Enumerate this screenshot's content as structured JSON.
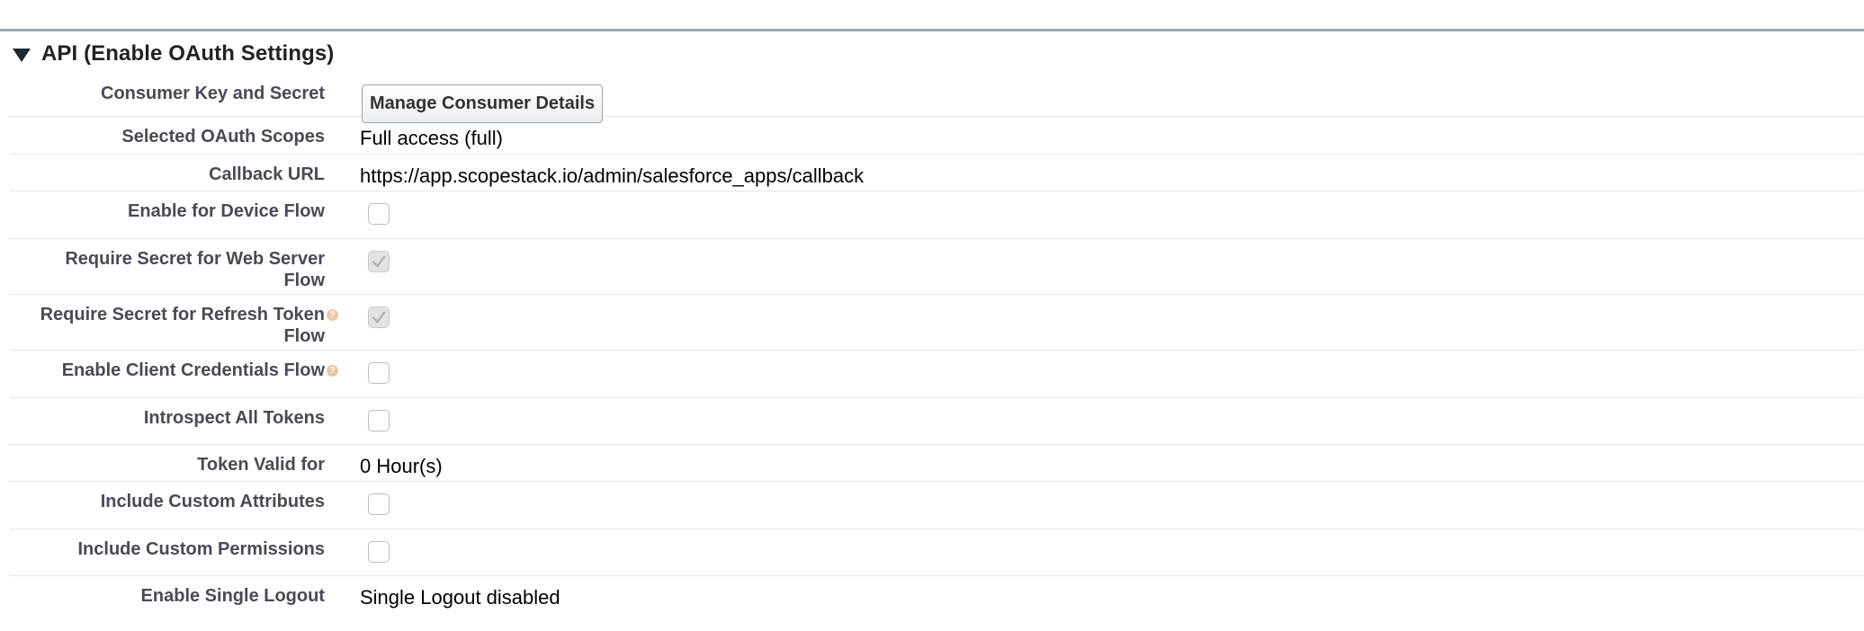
{
  "section": {
    "title": "API (Enable OAuth Settings)"
  },
  "rows": [
    {
      "label": "Consumer Key and Secret",
      "type": "button",
      "button_label": "Manage Consumer Details"
    },
    {
      "label": "Selected OAuth Scopes",
      "type": "text",
      "value": "Full access (full)"
    },
    {
      "label": "Callback URL",
      "type": "text",
      "value": "https://app.scopestack.io/admin/salesforce_apps/callback"
    },
    {
      "label": "Enable for Device Flow",
      "type": "checkbox",
      "checked": false
    },
    {
      "label_line1": "Require Secret for Web Server",
      "label_line2": "Flow",
      "type": "checkbox",
      "checked": true,
      "disabled": true
    },
    {
      "label_line1": "Require Secret for Refresh Token",
      "label_line2": "Flow",
      "type": "checkbox",
      "checked": true,
      "disabled": true,
      "help": true
    },
    {
      "label": "Enable Client Credentials Flow",
      "type": "checkbox",
      "checked": false,
      "help": true
    },
    {
      "label": "Introspect All Tokens",
      "type": "checkbox",
      "checked": false
    },
    {
      "label": "Token Valid for",
      "type": "text",
      "value": "0 Hour(s)"
    },
    {
      "label": "Include Custom Attributes",
      "type": "checkbox",
      "checked": false
    },
    {
      "label": "Include Custom Permissions",
      "type": "checkbox",
      "checked": false
    },
    {
      "label": "Enable Single Logout",
      "type": "text",
      "value": "Single Logout disabled"
    }
  ],
  "icons": {
    "section_toggle": "triangle-down-icon",
    "help": "help-icon",
    "help_glyph": "?",
    "checkmark": "checkmark-icon"
  },
  "colors": {
    "header_rule": "#97a6b5",
    "label_text": "#4a4a56",
    "row_divider": "#e3e6ea",
    "help_icon": "#e9c9a3"
  }
}
